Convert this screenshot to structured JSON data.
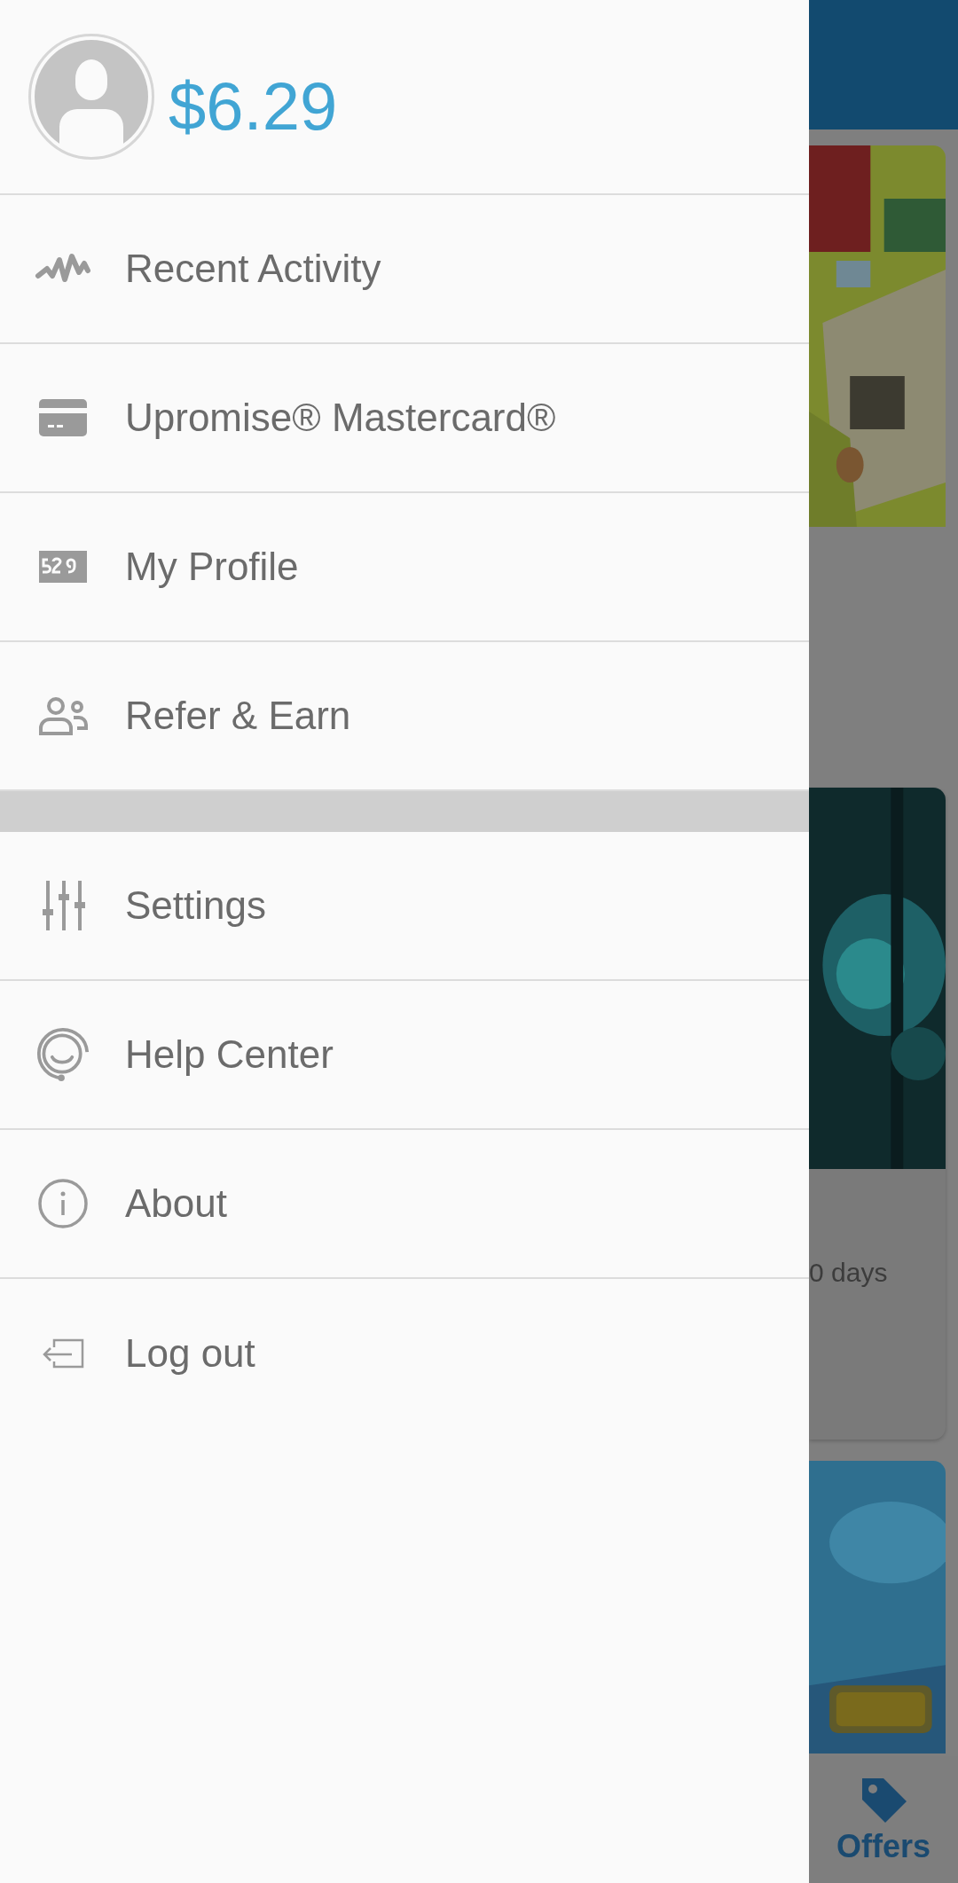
{
  "header": {
    "balance": "$6.29"
  },
  "menu_sections": [
    {
      "items": [
        {
          "kind": "activity",
          "label": "Recent Activity"
        },
        {
          "kind": "card",
          "label": "Upromise® Mastercard®"
        },
        {
          "kind": "profile",
          "label": "My Profile"
        },
        {
          "kind": "refer",
          "label": "Refer & Earn"
        }
      ]
    },
    {
      "items": [
        {
          "kind": "settings",
          "label": "Settings"
        },
        {
          "kind": "help",
          "label": "Help Center"
        },
        {
          "kind": "about",
          "label": "About"
        },
        {
          "kind": "logout",
          "label": "Log out"
        }
      ]
    }
  ],
  "background": {
    "cards": [
      {
        "kind": "picture"
      },
      {
        "kind": "picture",
        "text": "0 days"
      },
      {
        "kind": "picture"
      }
    ],
    "bottom_nav": {
      "label": "Offers",
      "selected": true
    }
  }
}
